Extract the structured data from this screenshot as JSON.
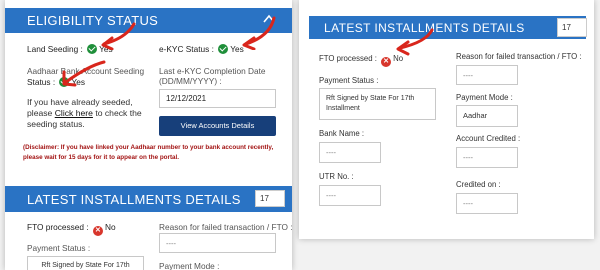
{
  "eligibility": {
    "title": "ELIGIBILITY STATUS",
    "land_seeding_label": "Land Seeding :",
    "land_seeding_value": "Yes",
    "ekyc_label": "e-KYC Status :",
    "ekyc_value": "Yes",
    "aadhaar_label_1": "Aadhaar Bank Account Seeding",
    "aadhaar_label_2": "Status :",
    "aadhaar_value": "Yes",
    "ekyc_date_label_1": "Last e-KYC Completion Date",
    "ekyc_date_label_2": "(DD/MM/YYYY) :",
    "ekyc_date_value": "12/12/2021",
    "seeded_text_1": "If you have already seeded,",
    "seeded_text_2_pre": "please ",
    "seeded_link": "Click here",
    "seeded_text_2_post": " to check the",
    "seeded_text_3": "seeding status.",
    "view_button": "View Accounts Details",
    "disclaimer_1": "(Disclaimer: If you have linked your Aadhaar number to your bank account recently,",
    "disclaimer_2": "please wait for 15 days for it to appear on the portal."
  },
  "left_installments": {
    "title": "LATEST INSTALLMENTS DETAILS",
    "count": "17",
    "fto_label": "FTO processed :",
    "fto_value": "No",
    "reason_label": "Reason for failed transaction / FTO :",
    "reason_value": "----",
    "payment_status_label": "Payment Status :",
    "payment_status_value": "Rft Signed by State For 17th",
    "payment_mode_label": "Payment Mode :"
  },
  "right_installments": {
    "title": "LATEST INSTALLMENTS DETAILS",
    "count": "17",
    "fto_label": "FTO processed :",
    "fto_value": "No",
    "reason_label": "Reason for failed transaction / FTO :",
    "reason_value": "----",
    "payment_status_label": "Payment Status :",
    "payment_status_value_1": "Rft Signed by State For 17th",
    "payment_status_value_2": "Installment",
    "payment_mode_label": "Payment Mode :",
    "payment_mode_value": "Aadhar",
    "bank_name_label": "Bank Name :",
    "bank_name_value": "----",
    "account_credited_label": "Account Credited :",
    "account_credited_value": "----",
    "utr_label": "UTR No. :",
    "utr_value": "----",
    "credited_on_label": "Credited on :",
    "credited_on_value": "----"
  },
  "colors": {
    "header_blue": "#2a73c4",
    "button_navy": "#173f7a",
    "annotation_red": "#d9261c",
    "ok_green": "#1f8f3a"
  }
}
